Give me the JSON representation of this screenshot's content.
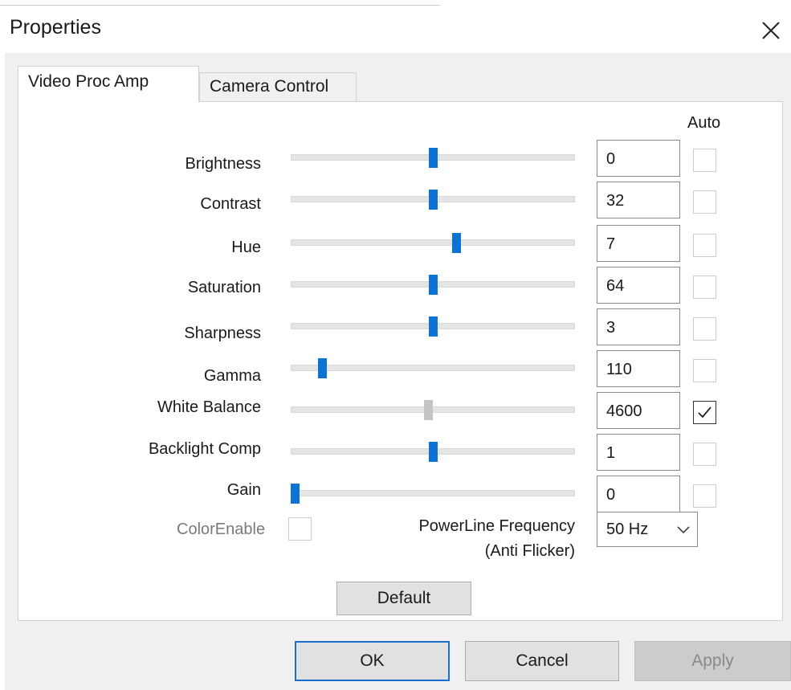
{
  "window": {
    "title": "Properties"
  },
  "tabs": [
    {
      "label": "Video Proc Amp",
      "active": true
    },
    {
      "label": "Camera Control",
      "active": false
    }
  ],
  "auto_header": "Auto",
  "controls": [
    {
      "label": "Brightness",
      "value": "0",
      "slider_fraction": 0.5,
      "auto": false,
      "enabled": true
    },
    {
      "label": "Contrast",
      "value": "32",
      "slider_fraction": 0.5,
      "auto": false,
      "enabled": true
    },
    {
      "label": "Hue",
      "value": "7",
      "slider_fraction": 0.585,
      "auto": false,
      "enabled": true
    },
    {
      "label": "Saturation",
      "value": "64",
      "slider_fraction": 0.5,
      "auto": false,
      "enabled": true
    },
    {
      "label": "Sharpness",
      "value": "3",
      "slider_fraction": 0.5,
      "auto": false,
      "enabled": true
    },
    {
      "label": "Gamma",
      "value": "110",
      "slider_fraction": 0.1,
      "auto": false,
      "enabled": true
    },
    {
      "label": "White Balance",
      "value": "4600",
      "slider_fraction": 0.485,
      "auto": true,
      "enabled": false
    },
    {
      "label": "Backlight Comp",
      "value": "1",
      "slider_fraction": 0.5,
      "auto": false,
      "enabled": true
    },
    {
      "label": "Gain",
      "value": "0",
      "slider_fraction": 0.0,
      "auto": false,
      "enabled": true
    }
  ],
  "color_enable": {
    "label": "ColorEnable",
    "checked": false
  },
  "powerline": {
    "label_line1": "PowerLine Frequency",
    "label_line2": "(Anti Flicker)",
    "selected": "50 Hz"
  },
  "buttons": {
    "default_label": "Default",
    "ok_label": "OK",
    "cancel_label": "Cancel",
    "apply_label": "Apply"
  },
  "colors": {
    "accent": "#0b73d6",
    "disabled_thumb": "#c4c4c4",
    "ok_border": "#1a6fd0"
  }
}
